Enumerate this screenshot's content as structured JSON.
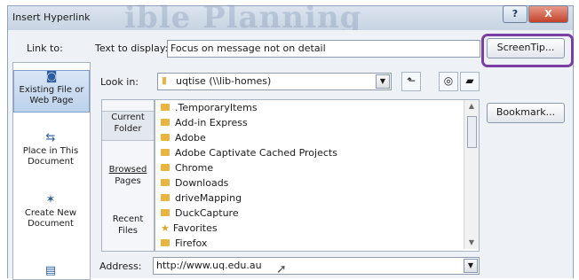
{
  "dialog": {
    "title": "Insert Hyperlink",
    "watermark": "ible Planning",
    "help_label": "?",
    "close_label": "X"
  },
  "link_to": {
    "label": "Link to:",
    "items": [
      {
        "label_line1": "Existing File or",
        "label_line2": "Web Page",
        "selected": true,
        "icon": "web-page-icon"
      },
      {
        "label_line1": "Place in This",
        "label_line2": "Document",
        "selected": false,
        "icon": "place-in-document-icon"
      },
      {
        "label_line1": "Create New",
        "label_line2": "Document",
        "selected": false,
        "icon": "new-document-icon"
      },
      {
        "label_line1": "",
        "label_line2": "",
        "selected": false,
        "icon": "email-icon"
      }
    ]
  },
  "text_to_display": {
    "label": "Text to display:",
    "value": "Focus on message not on detail"
  },
  "screentip_label": "ScreenTip...",
  "look_in": {
    "label": "Look in:",
    "value": "uqtise (\\\\lib-homes)"
  },
  "bookmark_label": "Bookmark...",
  "browse": {
    "items": [
      {
        "line1": "Current",
        "line2": "Folder",
        "selected": true
      },
      {
        "line1": "Browsed",
        "line2": "Pages",
        "selected": false
      },
      {
        "line1": "Recent",
        "line2": "Files",
        "selected": false
      }
    ]
  },
  "files": [
    {
      "name": ".TemporaryItems",
      "type": "folder"
    },
    {
      "name": "Add-in Express",
      "type": "folder"
    },
    {
      "name": "Adobe",
      "type": "folder"
    },
    {
      "name": "Adobe Captivate Cached Projects",
      "type": "folder"
    },
    {
      "name": "Chrome",
      "type": "folder"
    },
    {
      "name": "Downloads",
      "type": "folder"
    },
    {
      "name": "driveMapping",
      "type": "folder"
    },
    {
      "name": "DuckCapture",
      "type": "folder"
    },
    {
      "name": "Favorites",
      "type": "favorites"
    },
    {
      "name": "Firefox",
      "type": "folder"
    }
  ],
  "address": {
    "label": "Address:",
    "value": "http://www.uq.edu.au"
  },
  "colors": {
    "highlight": "#7a3fa3",
    "folder": "#e9b43f"
  }
}
